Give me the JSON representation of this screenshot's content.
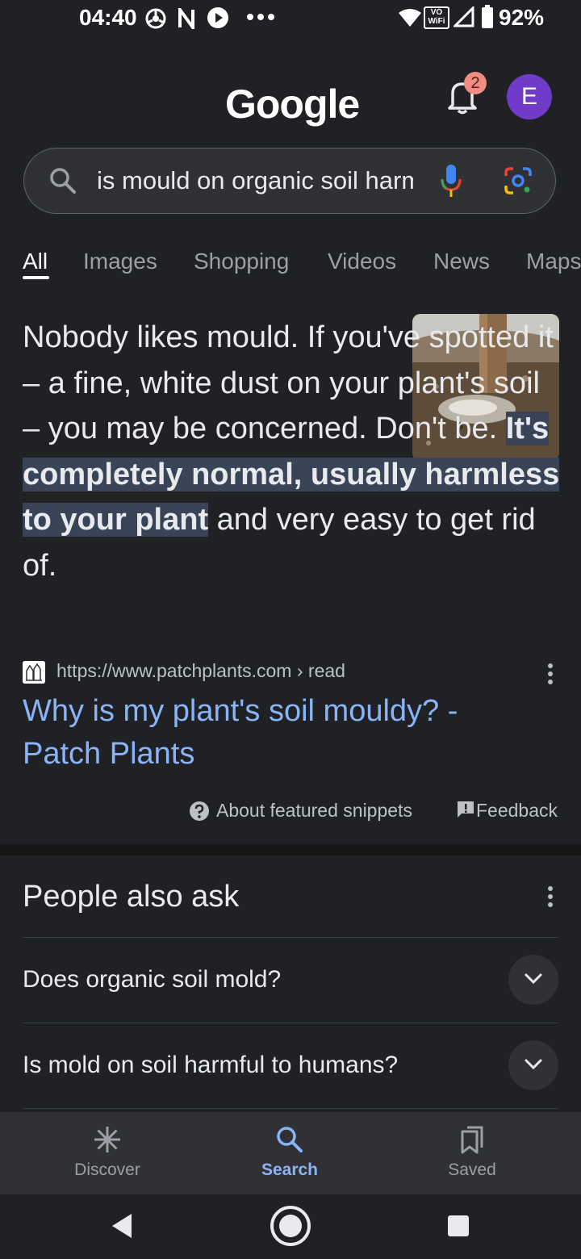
{
  "status_bar": {
    "time": "04:40",
    "battery": "92%",
    "icons": [
      "chrome-icon",
      "n-icon",
      "play-icon",
      "more-dots-icon",
      "wifi-icon",
      "vowifi-icon",
      "signal-icon",
      "battery-icon"
    ],
    "vowifi_text": "VO WiFi"
  },
  "header": {
    "logo": "Google",
    "notification_count": "2",
    "avatar_letter": "E"
  },
  "search": {
    "query": "is mould on organic soil harmful"
  },
  "tabs": [
    {
      "label": "All",
      "active": true
    },
    {
      "label": "Images"
    },
    {
      "label": "Shopping"
    },
    {
      "label": "Videos"
    },
    {
      "label": "News"
    },
    {
      "label": "Maps"
    }
  ],
  "featured_snippet": {
    "text_before": "Nobody likes mould. If you've spotted it – a fine, white dust on your plant's soil – you may be concerned. Don't be. ",
    "text_highlight": "It's completely normal, usually harmless to your plant",
    "text_after": " and very easy to get rid of.",
    "source_url": "https://www.patchplants.com › read",
    "result_title": "Why is my plant's soil mouldy? - Patch Plants",
    "about_label": "About featured snippets",
    "feedback_label": "Feedback"
  },
  "people_also_ask": {
    "title": "People also ask",
    "questions": [
      "Does organic soil mold?",
      "Is mold on soil harmful to humans?"
    ]
  },
  "bottom_nav": {
    "discover": "Discover",
    "search": "Search",
    "saved": "Saved"
  },
  "colors": {
    "background": "#202124",
    "link": "#8ab4f8",
    "highlight": "#394457",
    "avatar": "#6f3bc8",
    "badge": "#f28b82"
  }
}
